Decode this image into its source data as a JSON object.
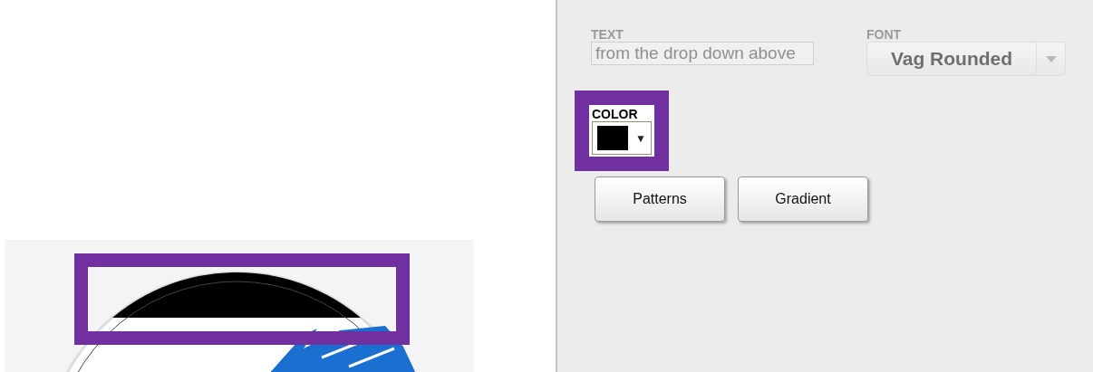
{
  "preview": {
    "highlighted": true
  },
  "text_field": {
    "label": "TEXT",
    "value": "from the drop down above",
    "disabled": true
  },
  "font_select": {
    "label": "FONT",
    "value": "Vag Rounded",
    "disabled": true
  },
  "color_picker": {
    "label": "COLOR",
    "color": "#000000",
    "arrow": "▼",
    "highlighted": true
  },
  "buttons": [
    "Patterns",
    "Gradient"
  ]
}
